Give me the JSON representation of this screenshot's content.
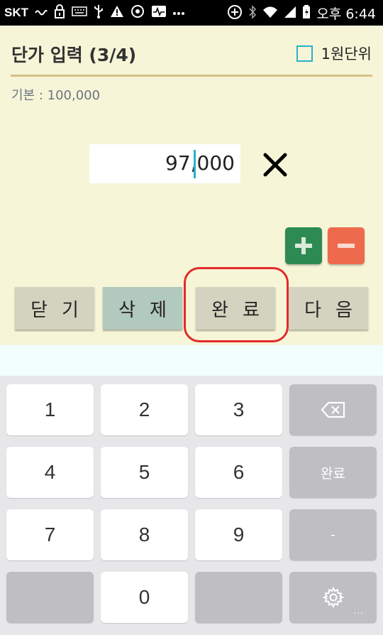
{
  "status_bar": {
    "carrier": "SKT",
    "time": "오후 6:44",
    "icons": [
      "signal-icon",
      "lock-icon",
      "keyboard-icon",
      "usb-icon",
      "warning-icon",
      "shield-icon",
      "pulse-icon",
      "more-icon",
      "sync-icon",
      "bluetooth-icon",
      "wifi-icon",
      "cell-signal-icon",
      "battery-icon"
    ]
  },
  "header": {
    "title": "단가 입력 (3/4)",
    "unit_checkbox_label": "1원단위",
    "unit_checkbox_checked": false
  },
  "base_price": "기본 : 100,000",
  "price_input": {
    "value": "97,000"
  },
  "adjust": {
    "plus_icon": "plus-icon",
    "minus_icon": "minus-icon"
  },
  "actions": {
    "close": "닫기",
    "delete": "삭제",
    "done": "완료",
    "next": "다음"
  },
  "keyboard": {
    "keys": [
      "1",
      "2",
      "3",
      "4",
      "5",
      "6",
      "7",
      "8",
      "9",
      "0"
    ],
    "done_label": "완료",
    "dash_label": "-",
    "more_dots": "..."
  },
  "colors": {
    "background": "#f6f5d8",
    "accent": "#2ab2c8",
    "plus": "#2e8a53",
    "minus": "#ee6a4d",
    "highlight": "#e22b2b"
  }
}
